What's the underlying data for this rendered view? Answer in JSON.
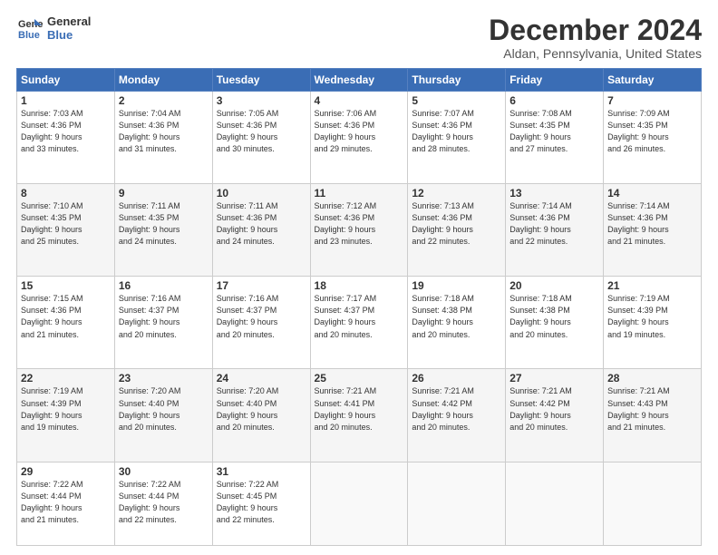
{
  "header": {
    "logo_line1": "General",
    "logo_line2": "Blue",
    "month": "December 2024",
    "location": "Aldan, Pennsylvania, United States"
  },
  "days_of_week": [
    "Sunday",
    "Monday",
    "Tuesday",
    "Wednesday",
    "Thursday",
    "Friday",
    "Saturday"
  ],
  "weeks": [
    [
      {
        "day": 1,
        "info": "Sunrise: 7:03 AM\nSunset: 4:36 PM\nDaylight: 9 hours\nand 33 minutes."
      },
      {
        "day": 2,
        "info": "Sunrise: 7:04 AM\nSunset: 4:36 PM\nDaylight: 9 hours\nand 31 minutes."
      },
      {
        "day": 3,
        "info": "Sunrise: 7:05 AM\nSunset: 4:36 PM\nDaylight: 9 hours\nand 30 minutes."
      },
      {
        "day": 4,
        "info": "Sunrise: 7:06 AM\nSunset: 4:36 PM\nDaylight: 9 hours\nand 29 minutes."
      },
      {
        "day": 5,
        "info": "Sunrise: 7:07 AM\nSunset: 4:36 PM\nDaylight: 9 hours\nand 28 minutes."
      },
      {
        "day": 6,
        "info": "Sunrise: 7:08 AM\nSunset: 4:35 PM\nDaylight: 9 hours\nand 27 minutes."
      },
      {
        "day": 7,
        "info": "Sunrise: 7:09 AM\nSunset: 4:35 PM\nDaylight: 9 hours\nand 26 minutes."
      }
    ],
    [
      {
        "day": 8,
        "info": "Sunrise: 7:10 AM\nSunset: 4:35 PM\nDaylight: 9 hours\nand 25 minutes."
      },
      {
        "day": 9,
        "info": "Sunrise: 7:11 AM\nSunset: 4:35 PM\nDaylight: 9 hours\nand 24 minutes."
      },
      {
        "day": 10,
        "info": "Sunrise: 7:11 AM\nSunset: 4:36 PM\nDaylight: 9 hours\nand 24 minutes."
      },
      {
        "day": 11,
        "info": "Sunrise: 7:12 AM\nSunset: 4:36 PM\nDaylight: 9 hours\nand 23 minutes."
      },
      {
        "day": 12,
        "info": "Sunrise: 7:13 AM\nSunset: 4:36 PM\nDaylight: 9 hours\nand 22 minutes."
      },
      {
        "day": 13,
        "info": "Sunrise: 7:14 AM\nSunset: 4:36 PM\nDaylight: 9 hours\nand 22 minutes."
      },
      {
        "day": 14,
        "info": "Sunrise: 7:14 AM\nSunset: 4:36 PM\nDaylight: 9 hours\nand 21 minutes."
      }
    ],
    [
      {
        "day": 15,
        "info": "Sunrise: 7:15 AM\nSunset: 4:36 PM\nDaylight: 9 hours\nand 21 minutes."
      },
      {
        "day": 16,
        "info": "Sunrise: 7:16 AM\nSunset: 4:37 PM\nDaylight: 9 hours\nand 20 minutes."
      },
      {
        "day": 17,
        "info": "Sunrise: 7:16 AM\nSunset: 4:37 PM\nDaylight: 9 hours\nand 20 minutes."
      },
      {
        "day": 18,
        "info": "Sunrise: 7:17 AM\nSunset: 4:37 PM\nDaylight: 9 hours\nand 20 minutes."
      },
      {
        "day": 19,
        "info": "Sunrise: 7:18 AM\nSunset: 4:38 PM\nDaylight: 9 hours\nand 20 minutes."
      },
      {
        "day": 20,
        "info": "Sunrise: 7:18 AM\nSunset: 4:38 PM\nDaylight: 9 hours\nand 20 minutes."
      },
      {
        "day": 21,
        "info": "Sunrise: 7:19 AM\nSunset: 4:39 PM\nDaylight: 9 hours\nand 19 minutes."
      }
    ],
    [
      {
        "day": 22,
        "info": "Sunrise: 7:19 AM\nSunset: 4:39 PM\nDaylight: 9 hours\nand 19 minutes."
      },
      {
        "day": 23,
        "info": "Sunrise: 7:20 AM\nSunset: 4:40 PM\nDaylight: 9 hours\nand 20 minutes."
      },
      {
        "day": 24,
        "info": "Sunrise: 7:20 AM\nSunset: 4:40 PM\nDaylight: 9 hours\nand 20 minutes."
      },
      {
        "day": 25,
        "info": "Sunrise: 7:21 AM\nSunset: 4:41 PM\nDaylight: 9 hours\nand 20 minutes."
      },
      {
        "day": 26,
        "info": "Sunrise: 7:21 AM\nSunset: 4:42 PM\nDaylight: 9 hours\nand 20 minutes."
      },
      {
        "day": 27,
        "info": "Sunrise: 7:21 AM\nSunset: 4:42 PM\nDaylight: 9 hours\nand 20 minutes."
      },
      {
        "day": 28,
        "info": "Sunrise: 7:21 AM\nSunset: 4:43 PM\nDaylight: 9 hours\nand 21 minutes."
      }
    ],
    [
      {
        "day": 29,
        "info": "Sunrise: 7:22 AM\nSunset: 4:44 PM\nDaylight: 9 hours\nand 21 minutes."
      },
      {
        "day": 30,
        "info": "Sunrise: 7:22 AM\nSunset: 4:44 PM\nDaylight: 9 hours\nand 22 minutes."
      },
      {
        "day": 31,
        "info": "Sunrise: 7:22 AM\nSunset: 4:45 PM\nDaylight: 9 hours\nand 22 minutes."
      },
      null,
      null,
      null,
      null
    ]
  ]
}
